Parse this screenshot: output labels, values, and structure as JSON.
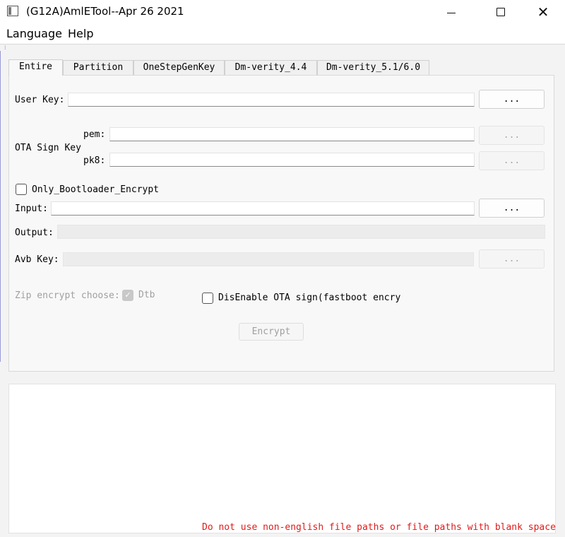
{
  "window": {
    "title": "(G12A)AmlETool--Apr 26 2021",
    "close_glyph": "✕"
  },
  "menu": {
    "language": "Language",
    "help": "Help"
  },
  "tabs": [
    "Entire",
    "Partition",
    "OneStepGenKey",
    "Dm-verity_4.4",
    "Dm-verity_5.1/6.0"
  ],
  "active_tab": "Entire",
  "form": {
    "user_key": {
      "label": "User Key:",
      "value": "",
      "button": "..."
    },
    "ota_sign_key": {
      "label": "OTA Sign Key",
      "pem_label": "pem:",
      "pem_value": "",
      "pem_button": "...",
      "pk8_label": "pk8:",
      "pk8_value": "",
      "pk8_button": "..."
    },
    "only_bootloader_encrypt": {
      "label": "Only_Bootloader_Encrypt",
      "checked": false
    },
    "input": {
      "label": "Input:",
      "value": "",
      "button": "..."
    },
    "output": {
      "label": "Output:",
      "value": ""
    },
    "avb_key": {
      "label": "Avb Key:",
      "value": "",
      "button": "..."
    },
    "zip_encrypt": {
      "label": "Zip encrypt choose:",
      "dtb_label": "Dtb",
      "dtb_checked": true,
      "check_glyph": "✓"
    },
    "disable_ota_sign": {
      "label": "DisEnable OTA sign(fastboot encryp",
      "checked": false
    },
    "encrypt_button": "Encrypt"
  },
  "log": {
    "text": ""
  },
  "warning": "Do not use non-english file paths or file paths with blank space",
  "colors": {
    "warning": "#e01b1b",
    "disabled_text": "#a0a0a0"
  }
}
